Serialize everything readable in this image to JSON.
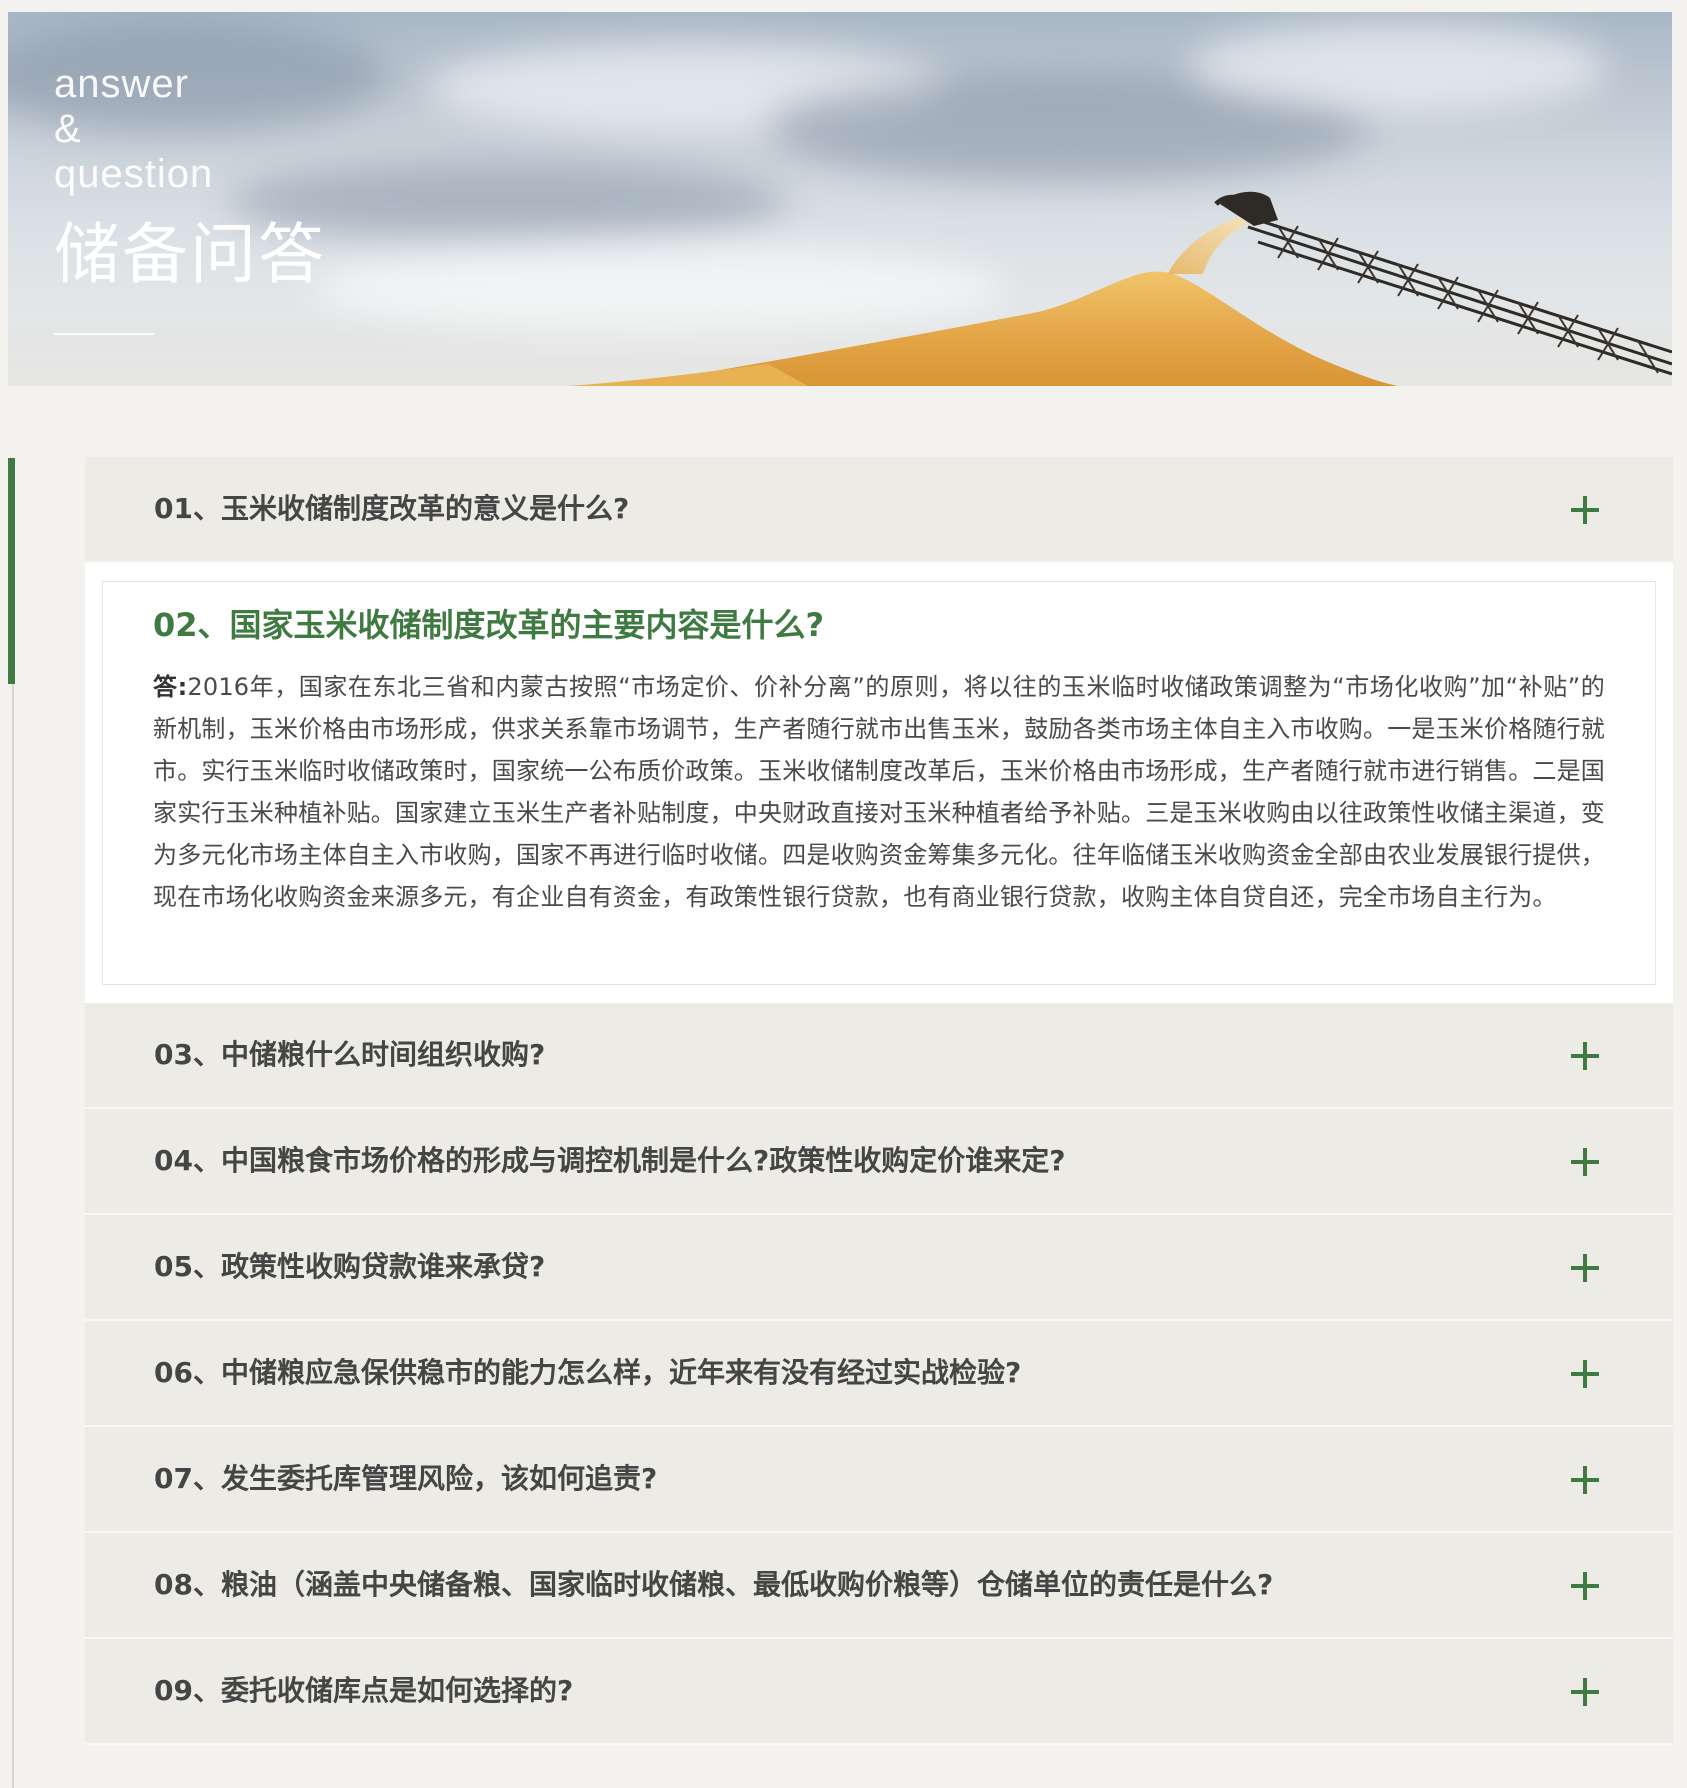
{
  "banner": {
    "english": "answer\n&\nquestion",
    "title": "储备问答"
  },
  "faq": {
    "open_item": {
      "title": "02、国家玉米收储制度改革的主要内容是什么?",
      "answer_label": "答:",
      "answer_text": "2016年，国家在东北三省和内蒙古按照“市场定价、价补分离”的原则，将以往的玉米临时收储政策调整为“市场化收购”加“补贴”的新机制，玉米价格由市场形成，供求关系靠市场调节，生产者随行就市出售玉米，鼓励各类市场主体自主入市收购。一是玉米价格随行就市。实行玉米临时收储政策时，国家统一公布质价政策。玉米收储制度改革后，玉米价格由市场形成，生产者随行就市进行销售。二是国家实行玉米种植补贴。国家建立玉米生产者补贴制度，中央财政直接对玉米种植者给予补贴。三是玉米收购由以往政策性收储主渠道，变为多元化市场主体自主入市收购，国家不再进行临时收储。四是收购资金筹集多元化。往年临储玉米收购资金全部由农业发展银行提供，现在市场化收购资金来源多元，有企业自有资金，有政策性银行贷款，也有商业银行贷款，收购主体自贷自还，完全市场自主行为。"
    },
    "items": [
      {
        "label": "01、玉米收储制度改革的意义是什么?"
      },
      {
        "label": "03、中储粮什么时间组织收购?"
      },
      {
        "label": "04、中国粮食市场价格的形成与调控机制是什么?政策性收购定价谁来定?"
      },
      {
        "label": "05、政策性收购贷款谁来承贷?"
      },
      {
        "label": "06、中储粮应急保供稳市的能力怎么样，近年来有没有经过实战检验?"
      },
      {
        "label": "07、发生委托库管理风险，该如何追责?"
      },
      {
        "label": "08、粮油（涵盖中央储备粮、国家临时收储粮、最低收购价粮等）仓储单位的责任是什么?"
      },
      {
        "label": "09、委托收储库点是如何选择的?"
      }
    ]
  },
  "colors": {
    "accent": "#3e7a42",
    "question_text": "#454545",
    "item_bg": "#edebe6",
    "page_bg": "#f4f2ee"
  },
  "icons": {
    "expand": "plus-icon"
  }
}
